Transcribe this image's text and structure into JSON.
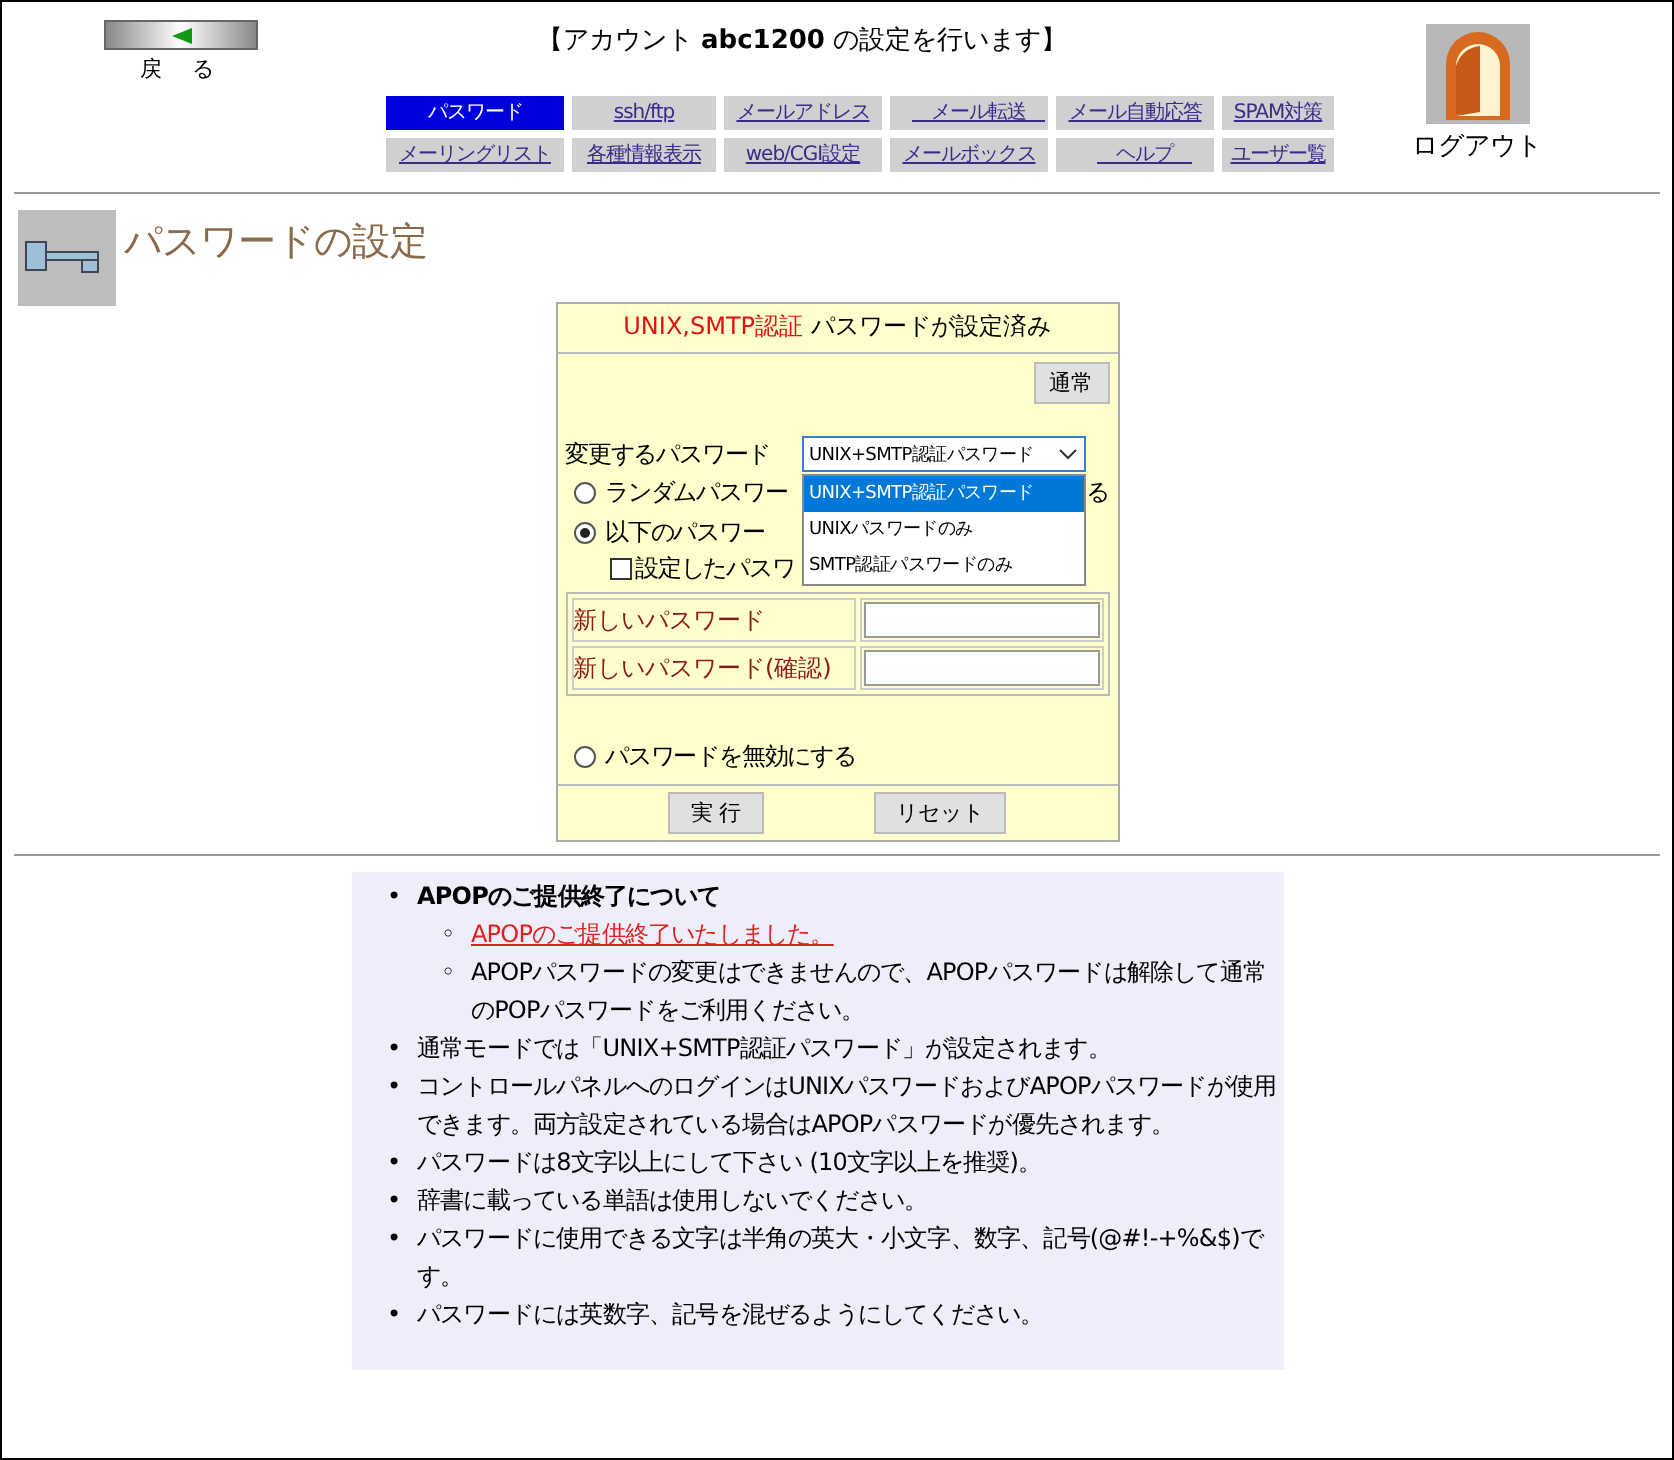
{
  "back": {
    "label": "戻　る"
  },
  "heading": "【アカウント **abc1200** の設定を行います】",
  "logout": {
    "label": "ログアウト"
  },
  "nav": [
    {
      "label": "パスワード",
      "selected": true
    },
    {
      "label": "ssh/ftp",
      "selected": false
    },
    {
      "label": "メールアドレス",
      "selected": false
    },
    {
      "label": "　メール転送　",
      "selected": false
    },
    {
      "label": "メール自動応答",
      "selected": false
    },
    {
      "label": "SPAM対策",
      "selected": false
    },
    {
      "label": "メーリングリスト",
      "selected": false
    },
    {
      "label": "各種情報表示",
      "selected": false
    },
    {
      "label": "web/CGI設定",
      "selected": false
    },
    {
      "label": "メールボックス",
      "selected": false
    },
    {
      "label": "　ヘルプ　",
      "selected": false
    },
    {
      "label": "ユーザー覧",
      "selected": false
    }
  ],
  "page_title": "パスワードの設定",
  "status": {
    "highlight": "UNIX,SMTP認証",
    "text": "パスワードが設定済み"
  },
  "mode_button": "通常",
  "password_select": {
    "label": "変更するパスワード",
    "value": "UNIX+SMTP認証パスワード",
    "expanded": true,
    "options": [
      {
        "label": "UNIX+SMTP認証パスワード",
        "selected": true
      },
      {
        "label": "UNIXパスワードのみ",
        "selected": false
      },
      {
        "label": "SMTP認証パスワードのみ",
        "selected": false
      }
    ]
  },
  "options": [
    {
      "kind": "radio",
      "label": "ランダムパスワー",
      "tail": "る",
      "checked": false
    },
    {
      "kind": "radio",
      "label": "以下のパスワー",
      "checked": true
    },
    {
      "kind": "checkbox",
      "label": "設定したパスワ",
      "checked": false
    }
  ],
  "fields": [
    {
      "label": "新しいパスワード"
    },
    {
      "label": "新しいパスワード(確認)"
    }
  ],
  "disable_option": {
    "label": "パスワードを無効にする",
    "checked": false
  },
  "buttons": [
    "実 行",
    "リセット"
  ],
  "notes": [
    {
      "kind": "heading",
      "marker": "•",
      "text": "APOPのご提供終了について",
      "children": [
        {
          "kind": "link",
          "marker": "◦",
          "text": "APOPのご提供終了いたしました。"
        },
        {
          "kind": "text",
          "marker": "◦",
          "text": "APOPパスワードの変更はできませんので、APOPパスワードは解除して通常のPOPパスワードをご利用ください。"
        }
      ]
    },
    {
      "kind": "text",
      "marker": "•",
      "text": "通常モードでは「UNIX+SMTP認証パスワード」が設定されます。"
    },
    {
      "kind": "text",
      "marker": "•",
      "text": "コントロールパネルへのログインはUNIXパスワードおよびAPOPパスワードが使用できます。両方設定されている場合はAPOPパスワードが優先されます。"
    },
    {
      "kind": "text",
      "marker": "•",
      "text": "パスワードは8文字以上にして下さい (10文字以上を推奨)。"
    },
    {
      "kind": "text",
      "marker": "•",
      "text": "辞書に載っている単語は使用しないでください。"
    },
    {
      "kind": "text",
      "marker": "•",
      "text": "パスワードに使用できる文字は半角の英大・小文字、数字、記号(@#!-+%&$)です。"
    },
    {
      "kind": "text",
      "marker": "•",
      "text": "パスワードには英数字、記号を混ぜるようにしてください。"
    }
  ]
}
